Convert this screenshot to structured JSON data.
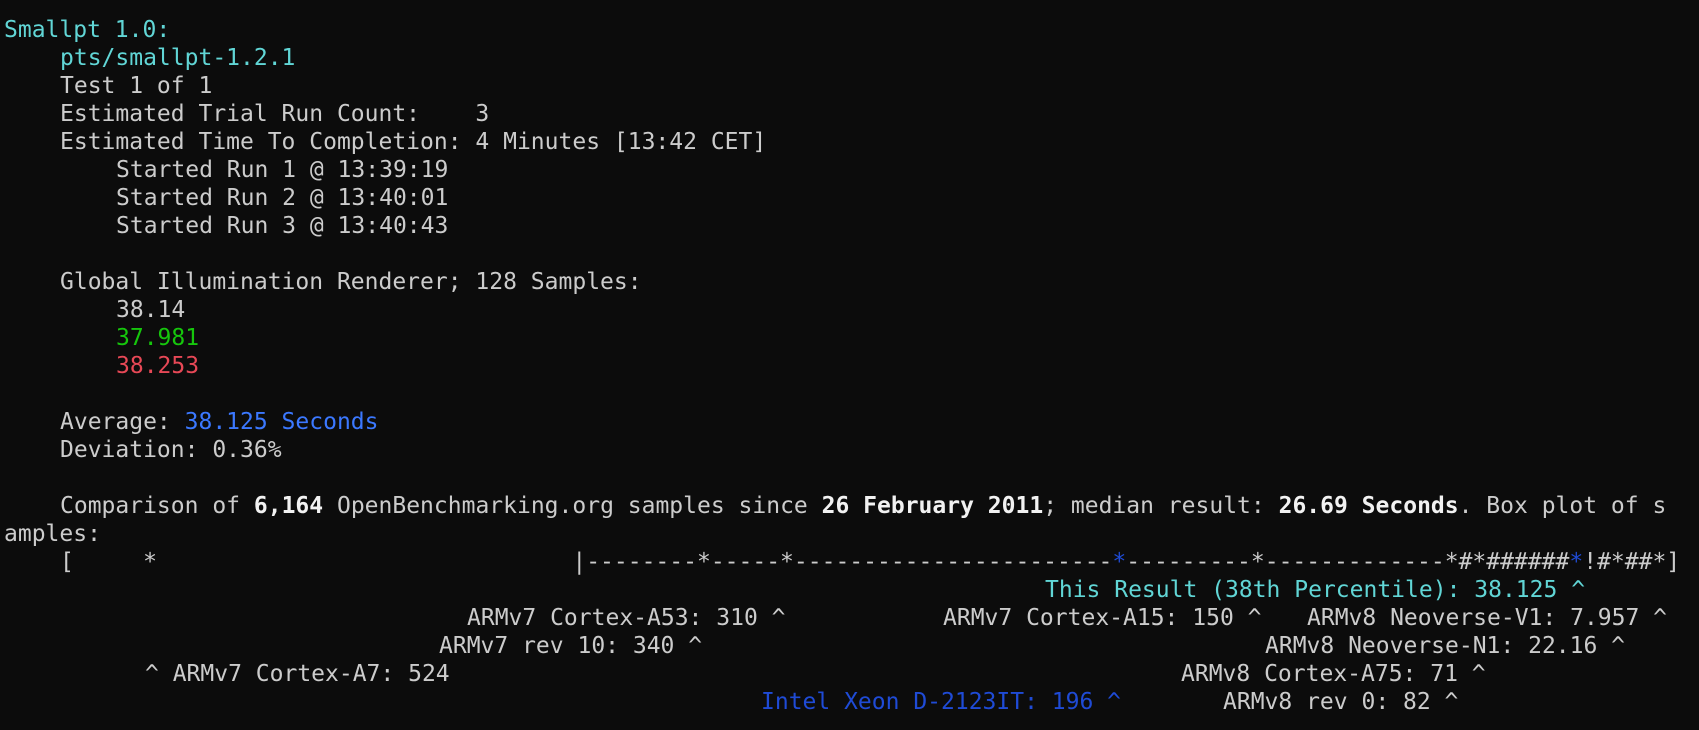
{
  "header": {
    "suite_title": "Smallpt 1.0:",
    "test_profile": "pts/smallpt-1.2.1",
    "test_index": "Test 1 of 1",
    "trial_count_label": "Estimated Trial Run Count:    3",
    "time_completion_label": "Estimated Time To Completion: 4 Minutes [13:42 CET]"
  },
  "runs": [
    "Started Run 1 @ 13:39:19",
    "Started Run 2 @ 13:40:01",
    "Started Run 3 @ 13:40:43"
  ],
  "result": {
    "test_label": "Global Illumination Renderer; 128 Samples:",
    "values": [
      "38.14",
      "37.981",
      "38.253"
    ],
    "average_label": "Average: ",
    "average_value": "38.125 Seconds",
    "deviation": "Deviation: 0.36%"
  },
  "comparison": {
    "prefix": "Comparison of ",
    "sample_count": "6,164",
    "mid1": " OpenBenchmarking.org samples since ",
    "since_date": "26 February 2011",
    "mid2": "; median result: ",
    "median": "26.69 Seconds",
    "suffix_line1": ". Box plot of s",
    "suffix_line2": "amples:"
  },
  "boxplot": {
    "left_part": "[     *                              |--------*-----*-----------------------",
    "this_marker": "*",
    "middle_part": "---------*-------------*#*######",
    "this_marker2": "*",
    "right_part": "!#*##*]"
  },
  "annotations": {
    "this_result": "This Result (38th Percentile): 38.125 ^",
    "a53": "ARMv7 Cortex-A53: 310 ^",
    "a15": "ARMv7 Cortex-A15: 150 ^",
    "v1": "ARMv8 Neoverse-V1: 7.957 ^",
    "rev10": "ARMv7 rev 10: 340 ^",
    "n1": "ARMv8 Neoverse-N1: 22.16 ^",
    "a7": "^ ARMv7 Cortex-A7: 524",
    "a75": "ARMv8 Cortex-A75: 71 ^",
    "xeon": "Intel Xeon D-2123IT: 196 ^",
    "rev0": "ARMv8 rev 0: 82 ^"
  }
}
